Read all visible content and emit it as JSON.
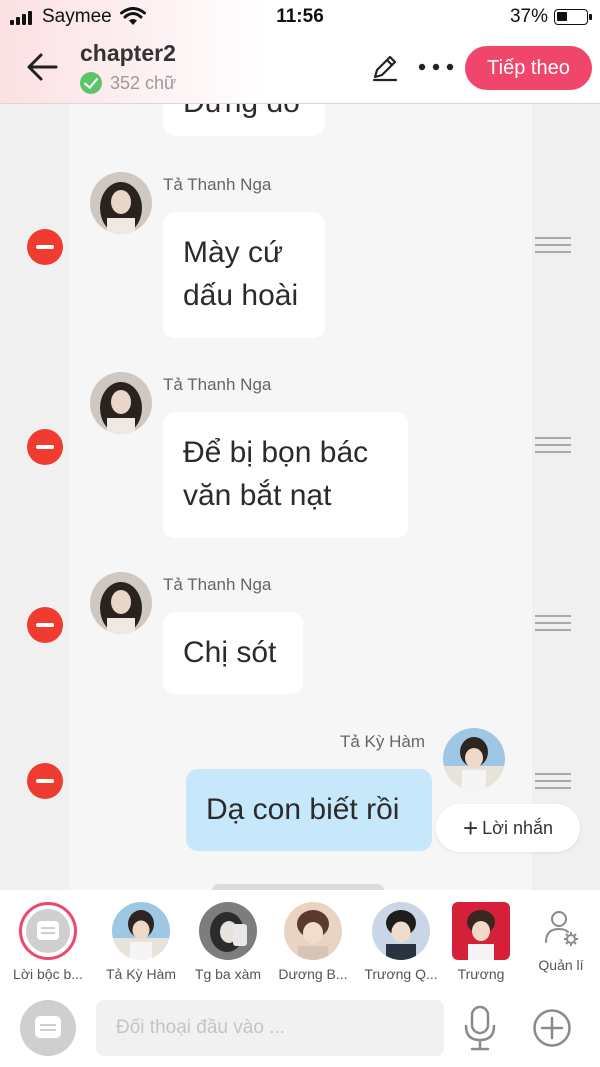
{
  "status_bar": {
    "carrier": "Saymee",
    "time": "11:56",
    "battery": "37%",
    "battery_level": 0.37
  },
  "header": {
    "title": "chapter2",
    "word_count": "352 chữ",
    "next_label": "Tiếp theo",
    "accent": "#f0466b"
  },
  "messages": [
    {
      "sender": "",
      "lines": [
        "Đừng đó"
      ]
    },
    {
      "sender": "Tả Thanh Nga",
      "lines": [
        "Mày cứ",
        "dấu hoài"
      ]
    },
    {
      "sender": "Tả Thanh Nga",
      "lines": [
        "Để bị bọn bác",
        "văn bắt nạt"
      ]
    },
    {
      "sender": "Tả Thanh Nga",
      "lines": [
        "Chị sót"
      ]
    },
    {
      "sender": "Tả Kỳ Hàm",
      "lines": [
        "Dạ con biết rồi"
      ]
    }
  ],
  "note_button": {
    "label": "Lời nhắn"
  },
  "characters": [
    {
      "name": "Lời bộc b..."
    },
    {
      "name": "Tả Kỳ Hàm"
    },
    {
      "name": "Tg ba xàm"
    },
    {
      "name": "Dương B..."
    },
    {
      "name": "Trương Q..."
    },
    {
      "name": "Trương"
    }
  ],
  "manage_label": "Quản lí",
  "input": {
    "placeholder": "Đối thoại đầu vào ..."
  },
  "icons": [
    "back-arrow-icon",
    "checkmark-icon",
    "pencil-icon",
    "more-icon",
    "delete-icon",
    "drag-handle-icon",
    "plus-icon",
    "person-gear-icon",
    "chat-bubble-icon",
    "microphone-icon",
    "add-circle-icon"
  ]
}
